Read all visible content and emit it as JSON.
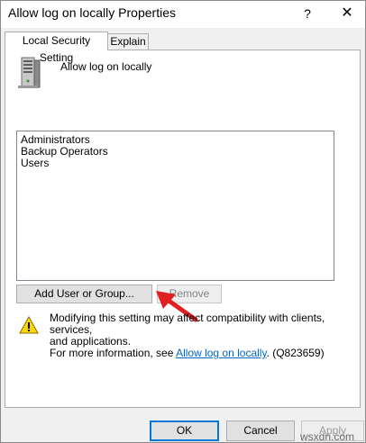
{
  "window": {
    "title": "Allow log on locally Properties",
    "help_glyph": "?",
    "close_glyph": "✕"
  },
  "tabs": [
    {
      "label": "Local Security Setting",
      "active": true
    },
    {
      "label": "Explain",
      "active": false
    }
  ],
  "policy": {
    "name": "Allow log on locally",
    "icon": "server-icon"
  },
  "members": [
    "Administrators",
    "Backup Operators",
    "Users"
  ],
  "buttons": {
    "add": "Add User or Group...",
    "remove": "Remove"
  },
  "warning": {
    "line1": "Modifying this setting may affect compatibility with clients, services,",
    "line2": "and applications.",
    "line3_prefix": "For more information, see ",
    "link": "Allow log on locally",
    "line3_suffix": ". (Q823659)",
    "icon": "warning-icon"
  },
  "footer": {
    "ok": "OK",
    "cancel": "Cancel",
    "apply": "Apply"
  },
  "watermark": "wsxdn.com",
  "colors": {
    "accent": "#0078d7",
    "link": "#0066cc",
    "arrow": "#e02020",
    "warning": "#ffd700"
  }
}
